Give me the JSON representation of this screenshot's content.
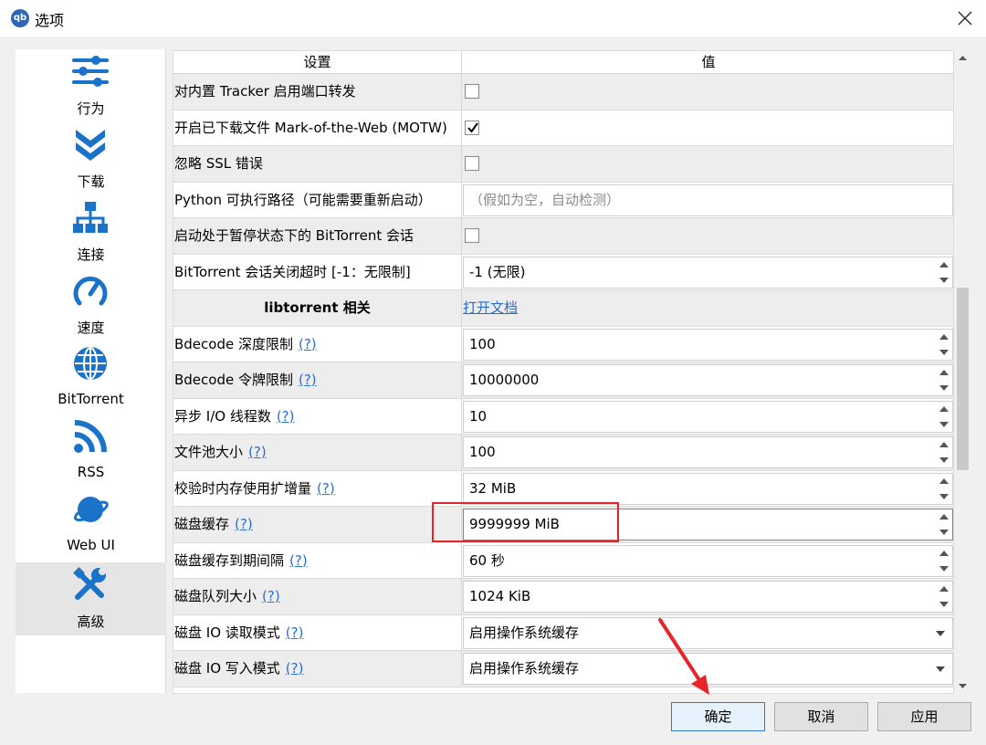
{
  "window": {
    "title": "选项",
    "app_icon": "qb"
  },
  "sidebar": {
    "items": [
      {
        "label": "行为",
        "icon": "sliders-icon"
      },
      {
        "label": "下载",
        "icon": "double-chevron-down-icon"
      },
      {
        "label": "连接",
        "icon": "network-icon"
      },
      {
        "label": "速度",
        "icon": "speedometer-icon"
      },
      {
        "label": "BitTorrent",
        "icon": "globe-icon"
      },
      {
        "label": "RSS",
        "icon": "rss-icon"
      },
      {
        "label": "Web UI",
        "icon": "planet-icon"
      },
      {
        "label": "高级",
        "icon": "tools-icon",
        "active": true
      }
    ]
  },
  "table": {
    "header": {
      "setting": "设置",
      "value": "值"
    },
    "rows": [
      {
        "label": "对内置 Tracker 启用端口转发",
        "type": "checkbox",
        "checked": false
      },
      {
        "label": "开启已下载文件 Mark-of-the-Web (MOTW)",
        "type": "checkbox",
        "checked": true
      },
      {
        "label": "忽略 SSL 错误",
        "type": "checkbox",
        "checked": false
      },
      {
        "label": "Python 可执行路径（可能需要重新启动）",
        "type": "text",
        "value": "",
        "placeholder": "（假如为空，自动检测）"
      },
      {
        "label": "启动处于暂停状态下的 BitTorrent 会话",
        "type": "checkbox",
        "checked": false
      },
      {
        "label": "BitTorrent 会话关闭超时 [-1：无限制]",
        "type": "spin",
        "value": "-1 (无限)"
      },
      {
        "label": "libtorrent 相关",
        "type": "section",
        "link": "打开文档"
      },
      {
        "label": "Bdecode 深度限制",
        "help": "(?)",
        "type": "spin",
        "value": "100"
      },
      {
        "label": "Bdecode 令牌限制",
        "help": "(?)",
        "type": "spin",
        "value": "10000000"
      },
      {
        "label": "异步 I/O 线程数",
        "help": "(?)",
        "type": "spin",
        "value": "10"
      },
      {
        "label": "文件池大小",
        "help": "(?)",
        "type": "spin",
        "value": "100"
      },
      {
        "label": "校验时内存使用扩增量",
        "help": "(?)",
        "type": "spin",
        "value": "32 MiB"
      },
      {
        "label": "磁盘缓存",
        "help": "(?)",
        "type": "spin",
        "value": "9999999 MiB",
        "focused": true
      },
      {
        "label": "磁盘缓存到期间隔",
        "help": "(?)",
        "type": "spin",
        "value": "60 秒"
      },
      {
        "label": "磁盘队列大小",
        "help": "(?)",
        "type": "spin",
        "value": "1024 KiB"
      },
      {
        "label": "磁盘 IO 读取模式",
        "help": "(?)",
        "type": "combo",
        "value": "启用操作系统缓存"
      },
      {
        "label": "磁盘 IO 写入模式",
        "help": "(?)",
        "type": "combo",
        "value": "启用操作系统缓存"
      }
    ]
  },
  "buttons": {
    "ok": "确定",
    "cancel": "取消",
    "apply": "应用"
  },
  "colors": {
    "accent": "#1a73c8",
    "annotation": "#e5252a",
    "link": "#2a6fc9"
  }
}
